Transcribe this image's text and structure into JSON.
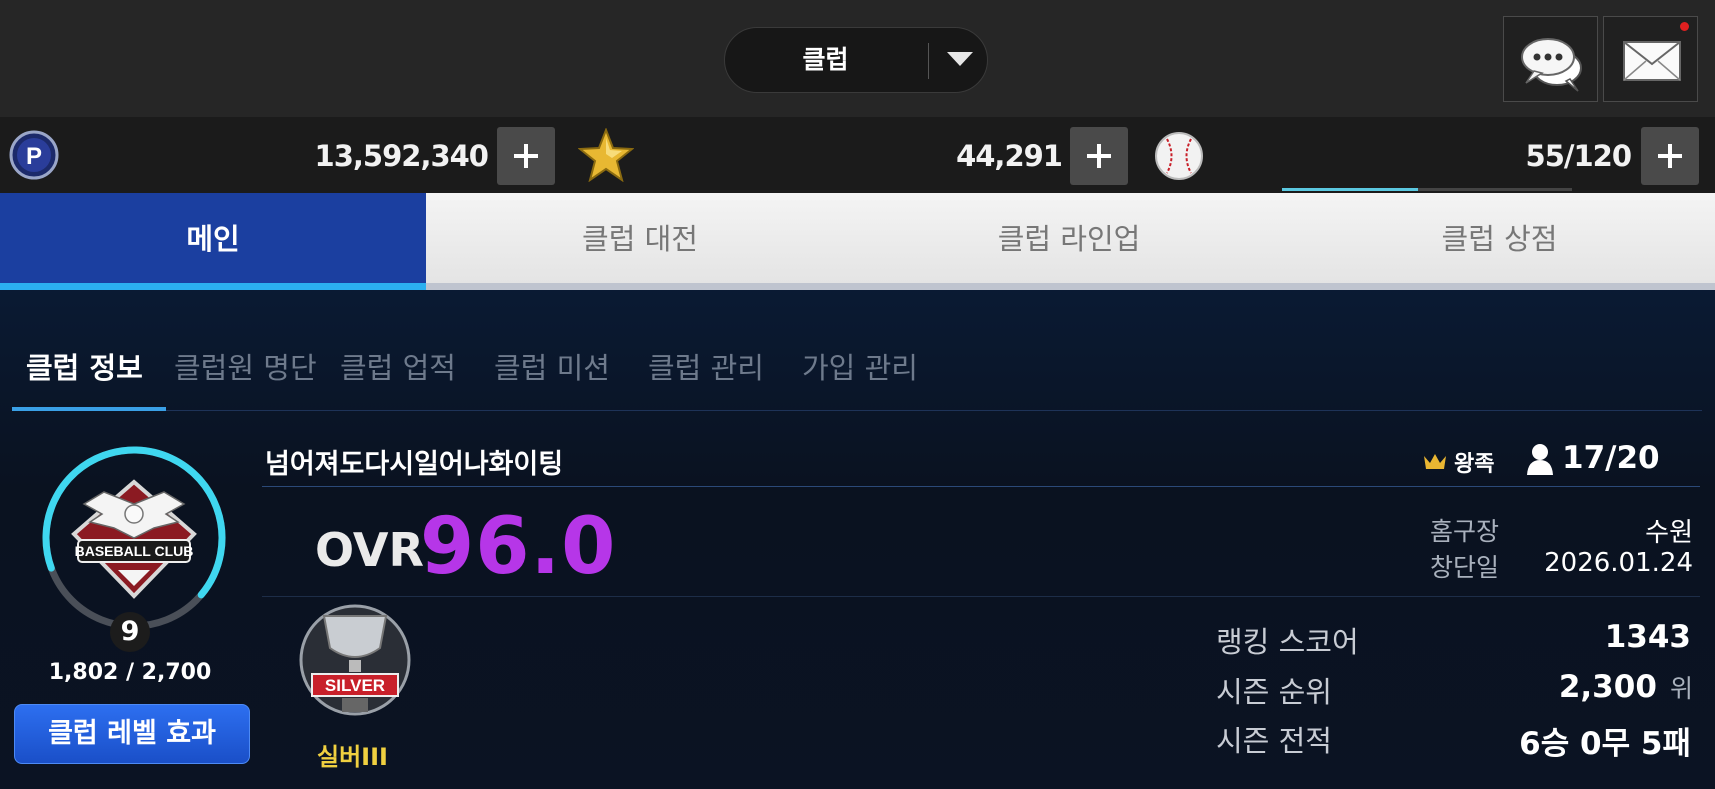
{
  "header": {
    "club_select_label": "클럽",
    "icons": [
      "chat-icon",
      "mail-icon"
    ]
  },
  "currencies": [
    {
      "icon": "p-coin-icon",
      "value": "13,592,340"
    },
    {
      "icon": "star-icon",
      "value": "44,291"
    },
    {
      "icon": "baseball-icon",
      "value": "55/120"
    }
  ],
  "tabs": [
    {
      "label": "메인",
      "active": true
    },
    {
      "label": "클럽 대전",
      "active": false
    },
    {
      "label": "클럽 라인업",
      "active": false
    },
    {
      "label": "클럽 상점",
      "active": false
    }
  ],
  "subtabs": [
    {
      "label": "클럽 정보",
      "active": true
    },
    {
      "label": "클럽원 명단",
      "active": false
    },
    {
      "label": "클럽 업적",
      "active": false
    },
    {
      "label": "클럽 미션",
      "active": false
    },
    {
      "label": "클럽 관리",
      "active": false
    },
    {
      "label": "가입 관리",
      "active": false
    }
  ],
  "club": {
    "emblem_text": "BASEBALL CLUB",
    "level": "9",
    "exp": "1,802 / 2,700",
    "exp_fraction": 0.667,
    "level_button": "클럽 레벨 효과",
    "name": "넘어져도다시일어나화이팅",
    "grade": "왕족",
    "members": "17/20",
    "ovr_label": "OVR",
    "ovr_value": "96.0",
    "home_label": "홈구장",
    "home_value": "수원",
    "founded_label": "창단일",
    "founded_value": "2026.01.24",
    "tier_badge_text": "SILVER",
    "tier": "실버III",
    "ranking_score_label": "랭킹 스코어",
    "ranking_score": "1343",
    "season_rank_label": "시즌 순위",
    "season_rank": "2,300",
    "season_rank_unit": "위",
    "season_record_label": "시즌 전적",
    "season_record": "6승 0무 5패"
  },
  "colors": {
    "accent_blue": "#1b3fa0",
    "ovr_purple": "#b636e8",
    "tier_gold": "#f0d040",
    "exp_ring": "#3fd7f0"
  }
}
